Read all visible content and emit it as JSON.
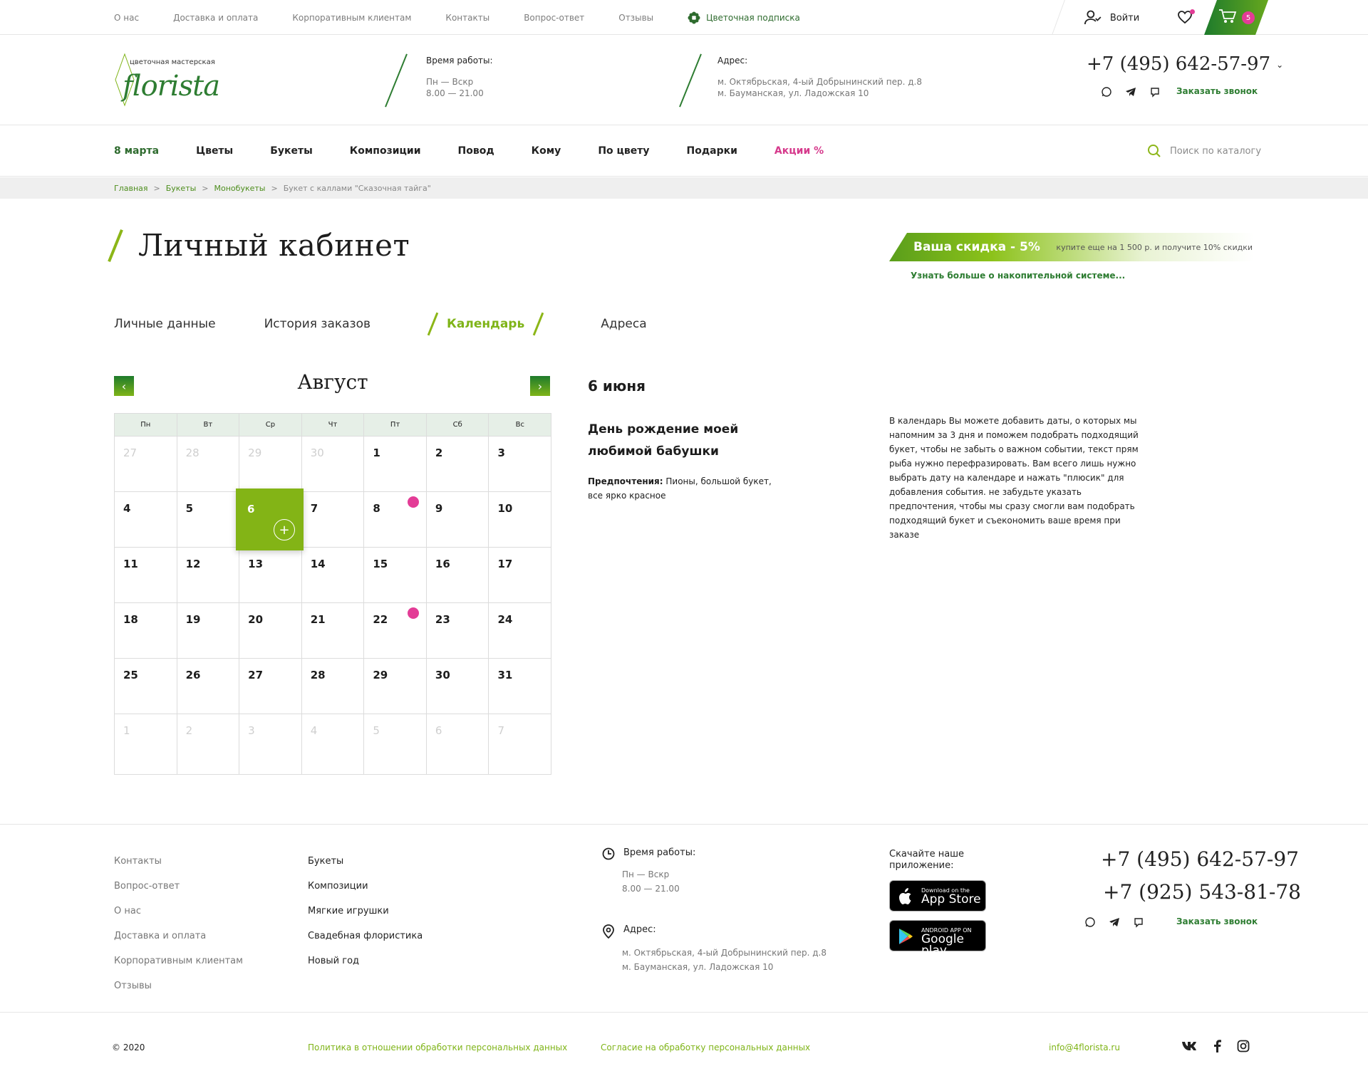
{
  "top_links": [
    "О нас",
    "Доставка и оплата",
    "Корпоративным клиентам",
    "Контакты",
    "Вопрос-ответ",
    "Отзывы"
  ],
  "top_subscription": "Цветочная подписка",
  "login_label": "Войти",
  "cart_count": "5",
  "logo": {
    "sub": "цветочная мастерская",
    "main": "florista"
  },
  "hours": {
    "title": "Время работы:",
    "days": "Пн — Вскр",
    "time": "8.00 — 21.00"
  },
  "address": {
    "title": "Адрес:",
    "line1": "м. Октябрьская, 4-ый Добрынинский пер. д.8",
    "line2": "м. Бауманская, ул. Ладожская 10"
  },
  "phone": "+7 (495) 642-57-97",
  "callback": "Заказать звонок",
  "nav": [
    "8 марта",
    "Цветы",
    "Букеты",
    "Композиции",
    "Повод",
    "Кому",
    "По цвету",
    "Подарки",
    "Акции %"
  ],
  "search_placeholder": "Поиск по каталогу",
  "breadcrumbs": [
    "Главная",
    "Букеты",
    "Монобукеты",
    "Букет с каллами \"Сказочная тайга\""
  ],
  "page_title": "Личный кабинет",
  "discount": {
    "label": "Ваша скидка - 5%",
    "note": "купите еще на 1 500 р. и получите 10% скидки",
    "more": "Узнать больше о накопительной системе..."
  },
  "tabs": [
    "Личные данные",
    "История заказов",
    "Календарь",
    "Адреса"
  ],
  "calendar": {
    "month": "Август",
    "weekdays": [
      "Пн",
      "Вт",
      "Ср",
      "Чт",
      "Пт",
      "Сб",
      "Вс"
    ],
    "rows": [
      [
        "27",
        "28",
        "29",
        "30",
        "1",
        "2",
        "3"
      ],
      [
        "4",
        "5",
        "6",
        "7",
        "8",
        "9",
        "10"
      ],
      [
        "11",
        "12",
        "13",
        "14",
        "15",
        "16",
        "17"
      ],
      [
        "18",
        "19",
        "20",
        "21",
        "22",
        "23",
        "24"
      ],
      [
        "25",
        "26",
        "27",
        "28",
        "29",
        "30",
        "31"
      ],
      [
        "1",
        "2",
        "3",
        "4",
        "5",
        "6",
        "7"
      ]
    ],
    "selected": "6",
    "plus": "+"
  },
  "event": {
    "date": "6 июня",
    "title": "День рождение моей любимой бабушки",
    "pref_label": "Предпочтения:",
    "pref_text": "Пионы, большой букет, все ярко красное"
  },
  "info": "В календарь Вы можете добавить даты, о которых мы напомним за 3 дня и поможем подобрать подходящий букет, чтобы не забыть о важном событии, текст прям рыба нужно перефразировать. Вам всего лишь нужно выбрать дату на календаре и нажать \"плюсик\" для добавления события. не забудьте указать предпочтения, чтобы мы сразу смогли вам подобрать подходящий букет и съекономить ваше время при заказе",
  "footer": {
    "col1": [
      "Контакты",
      "Вопрос-ответ",
      "О нас",
      "Доставка и оплата",
      "Корпоративным клиентам",
      "Отзывы"
    ],
    "col2": [
      "Букеты",
      "Композиции",
      "Мягкие игрушки",
      "Свадебная флористика",
      "Новый год"
    ],
    "app_title": "Скачайте наше приложение:",
    "appstore_small": "Download on the",
    "appstore_big": "App Store",
    "gplay_small": "ANDROID APP ON",
    "gplay_big": "Google play",
    "phone1": "+7 (495) 642-57-97",
    "phone2": "+7 (925) 543-81-78"
  },
  "bottom": {
    "copy": "© 2020",
    "policy": "Политика в отношении обработки персональных данных",
    "consent": "Согласие на обработку персональных данных",
    "email": "info@4florista.ru"
  }
}
